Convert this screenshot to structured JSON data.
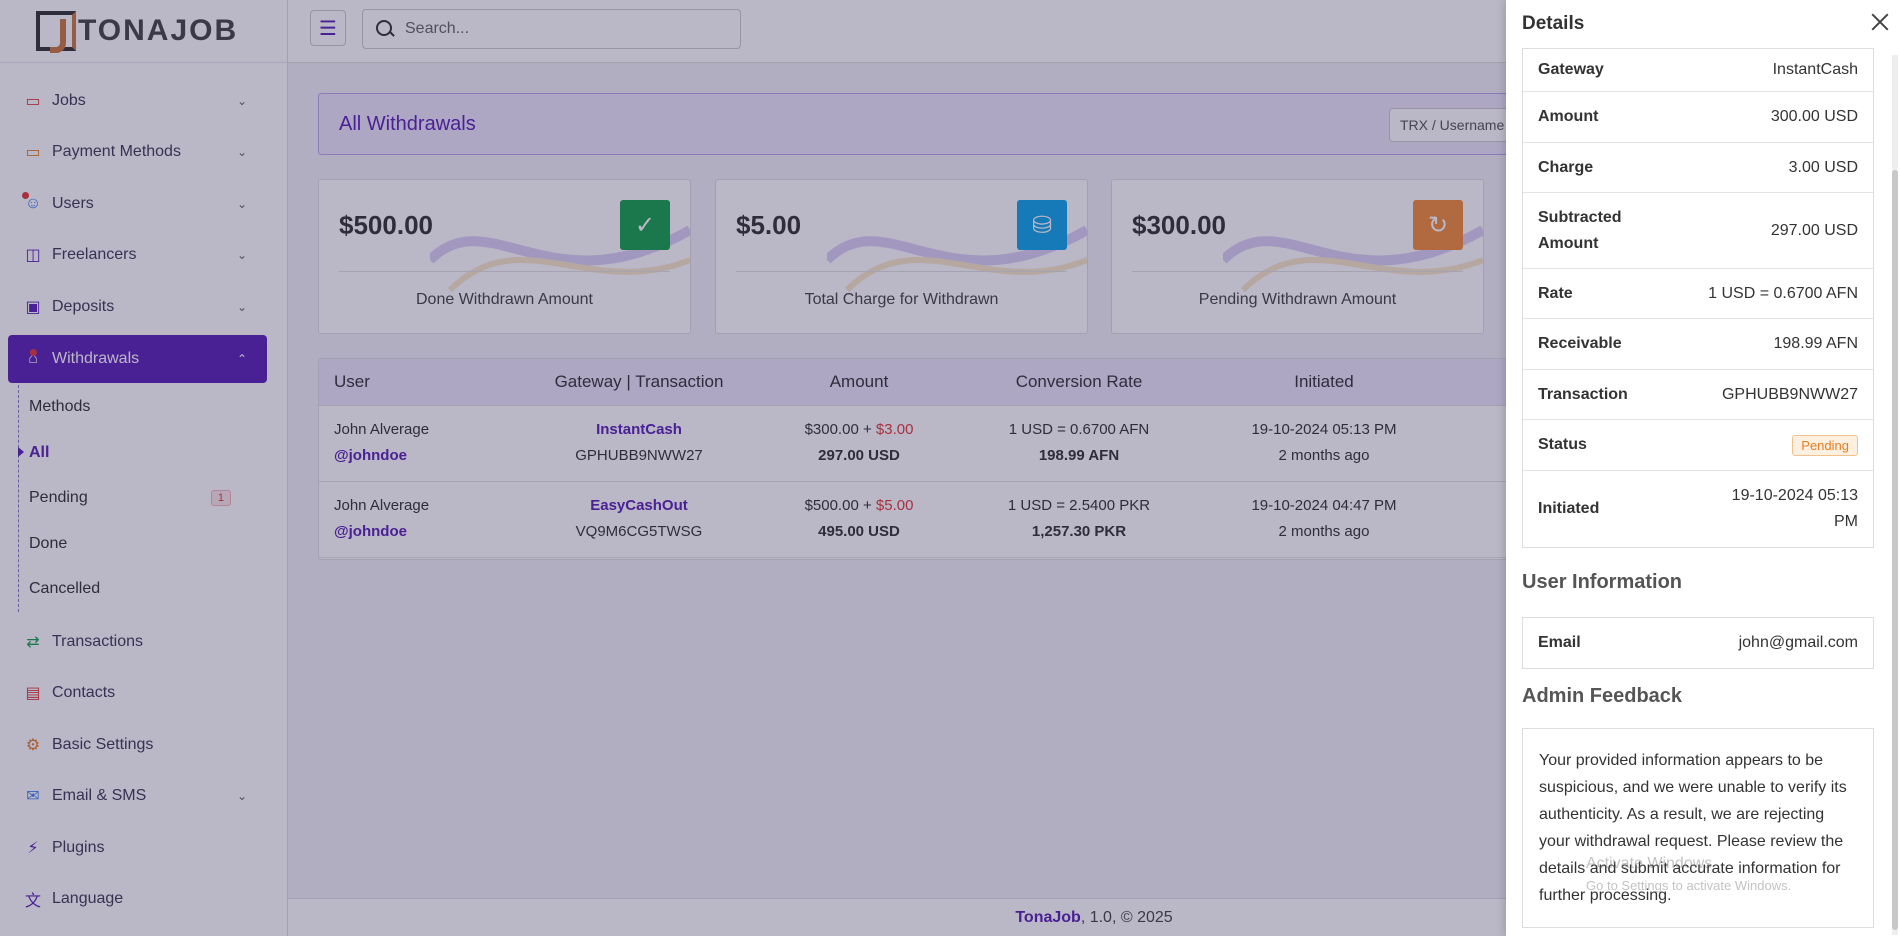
{
  "brand": {
    "name": "TONAJOB"
  },
  "topbar": {
    "search_placeholder": "Search..."
  },
  "sidebar": {
    "items": [
      {
        "label": "Jobs",
        "icon": "briefcase-icon"
      },
      {
        "label": "Payment Methods",
        "icon": "card-icon"
      },
      {
        "label": "Users",
        "icon": "users-icon"
      },
      {
        "label": "Freelancers",
        "icon": "freelancer-icon"
      },
      {
        "label": "Deposits",
        "icon": "deposit-icon"
      },
      {
        "label": "Withdrawals",
        "icon": "bank-icon"
      },
      {
        "label": "Transactions",
        "icon": "exchange-icon"
      },
      {
        "label": "Contacts",
        "icon": "contact-icon"
      },
      {
        "label": "Basic Settings",
        "icon": "gear-icon"
      },
      {
        "label": "Email & SMS",
        "icon": "mail-icon"
      },
      {
        "label": "Plugins",
        "icon": "plug-icon"
      },
      {
        "label": "Language",
        "icon": "language-icon"
      }
    ],
    "withdrawals_sub": [
      {
        "label": "Methods"
      },
      {
        "label": "All"
      },
      {
        "label": "Pending",
        "badge": "1"
      },
      {
        "label": "Done"
      },
      {
        "label": "Cancelled"
      }
    ]
  },
  "page": {
    "title": "All Withdrawals",
    "filter_placeholder": "TRX / Username"
  },
  "cards": [
    {
      "amount": "$500.00",
      "caption": "Done Withdrawn Amount",
      "color": "#16a34a"
    },
    {
      "amount": "$5.00",
      "caption": "Total Charge for Withdrawn",
      "color": "#0ea5e9"
    },
    {
      "amount": "$300.00",
      "caption": "Pending Withdrawn Amount",
      "color": "#f28c38"
    }
  ],
  "table": {
    "headers": [
      "User",
      "Gateway | Transaction",
      "Amount",
      "Conversion Rate",
      "Initiated"
    ],
    "rows": [
      {
        "user": "John Alverage",
        "username": "@johndoe",
        "gateway": "InstantCash",
        "trx": "GPHUBB9NWW27",
        "amount": "$300.00 + ",
        "charge": "$3.00",
        "net": "297.00 USD",
        "rate": "1 USD = 0.6700 AFN",
        "receivable": "198.99 AFN",
        "date": "19-10-2024 05:13 PM",
        "ago": "2 months ago"
      },
      {
        "user": "John Alverage",
        "username": "@johndoe",
        "gateway": "EasyCashOut",
        "trx": "VQ9M6CG5TWSG",
        "amount": "$500.00 + ",
        "charge": "$5.00",
        "net": "495.00 USD",
        "rate": "1 USD = 2.5400 PKR",
        "receivable": "1,257.30 PKR",
        "date": "19-10-2024 04:47 PM",
        "ago": "2 months ago"
      }
    ]
  },
  "footer": {
    "brand": "TonaJob",
    "rest": ", 1.0, © 2025"
  },
  "drawer": {
    "title": "Details",
    "rows": [
      {
        "k": "Gateway",
        "v": "InstantCash"
      },
      {
        "k": "Amount",
        "v": "300.00 USD"
      },
      {
        "k": "Charge",
        "v": "3.00 USD"
      },
      {
        "k": "Subtracted Amount",
        "v": "297.00 USD"
      },
      {
        "k": "Rate",
        "v": "1 USD = 0.6700 AFN"
      },
      {
        "k": "Receivable",
        "v": "198.99 AFN"
      },
      {
        "k": "Transaction",
        "v": "GPHUBB9NWW27"
      },
      {
        "k": "Status",
        "v": "Pending"
      },
      {
        "k": "Initiated",
        "v": "19-10-2024 05:13 PM"
      }
    ],
    "user_info_title": "User Information",
    "email_label": "Email",
    "email_value": "john@gmail.com",
    "feedback_title": "Admin Feedback",
    "feedback": "Your provided information appears to be suspicious, and we were unable to verify its authenticity. As a result, we are rejecting your withdrawal request. Please review the details and submit accurate information for further processing."
  },
  "watermark": {
    "line1": "Activate Windows",
    "line2": "Go to Settings to activate Windows."
  }
}
